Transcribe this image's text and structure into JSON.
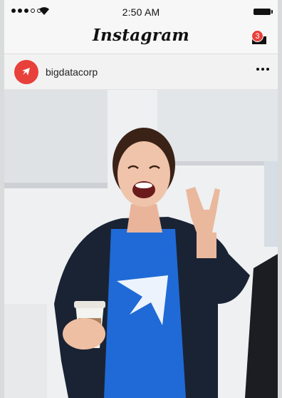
{
  "status_bar": {
    "time": "2:50 AM",
    "signal_bars": 3,
    "signal_total": 5
  },
  "header": {
    "title": "Instagram",
    "notifications_count": "3"
  },
  "post": {
    "username": "bigdatacorp",
    "avatar_icon": "bigdatacorp-logo-icon",
    "more_icon": "more-options-icon",
    "photo_description_icon": "post-photo"
  },
  "colors": {
    "accent": "#e8403a",
    "shirt": "#1f6ad6",
    "jacket": "#1a2333"
  }
}
